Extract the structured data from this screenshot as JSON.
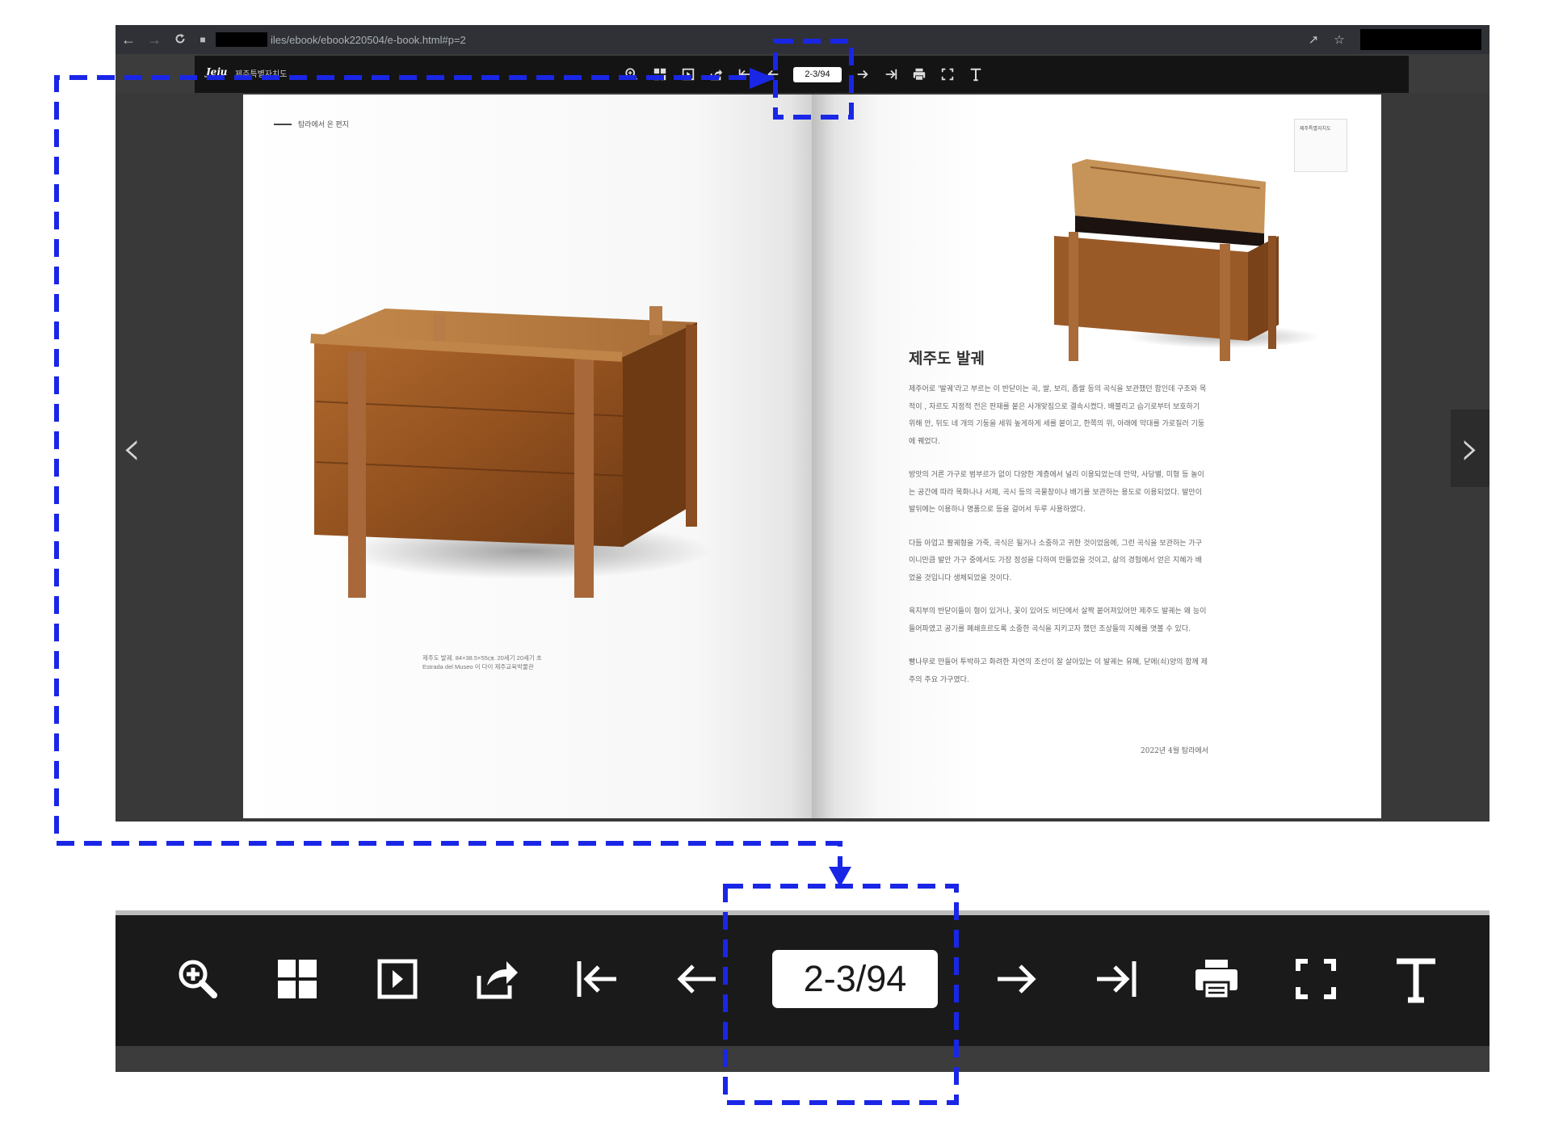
{
  "browser": {
    "url_visible": "iles/ebook/ebook220504/e-book.html#p=2",
    "back_label": "←",
    "forward_label": "→",
    "reload_label": "C"
  },
  "ebook": {
    "logo_text": "Jeju",
    "logo_sub": "제주특별자치도",
    "page_indicator": "2-3/94"
  },
  "left_page": {
    "running_head": "탐라에서 온 편지",
    "caption_line1": "제주도 발궤. 84×38.5×55㎝. 20세기 20세기 초",
    "caption_line2": "Estrada del Museo 이 다이 제주교육박물관"
  },
  "right_page": {
    "stamp_text": "제주특별자치도",
    "title": "제주도 발궤",
    "paragraphs": [
      "제주어로 '발궤'라고 부르는 이 반닫이는 곡, 쌀, 보리, 좁쌀 등의 곡식을 보관했던 함인데 구조와 목적이 , 자르도 지정적 전은 판재를 붙은 사개맞짐으로 결속시켰다. 배불리고 습기로부터 보호하기 위해 안, 뒤도 네 개의 기둥을 세워 높게하게 세를 붙이고, 한쪽의 위, 아래에 막대를 가로질러 기둥에 꿰었다.",
      "방앗의 거른 가구로 범부르가 없이 다양한 계층에서 널리 이용되었는데 만약, 사당별, 미형 등 놀이는 공간에 따라 목화나나 서제, 곡시 등의 곡물창이나 배기를 보관하는 용도로 이용되었다. 발안이 발뒤에는 이용하나 명품으로 등을 걸어서 두루 사용하였다.",
      "다듬 아업고 활궤형을 가죽, 곡식은 될거나 소중하고 귀한 것이었음에, 그런 곡식을 보관하는 가구이니만큼 발안 가구 중에서도 가장 정성을 다하여 만들었을 것이고, 삶의 경험에서 얻은 지혜가 배었을 것입니다 생체되었을 것이다.",
      "육지부의 반닫이들이 형이 있거나, 꽃이 있어도 비단에서 살짝 붙어져있어만 제주도 발궤는 왜 능이 들어파였고 공기를 폐쇄흐르도록 소중한 곡식을 지키고자 했던 조상들의 지혜를 엿볼 수 있다.",
      "빵나무로 만들어 투박하고 화려한 자연의 조선이 잘 살아있는 이 발궤는 유폐, 닫에(쇠)양의 함께 제주의 주요 가구였다."
    ],
    "signature": "2022년 4월 탐라에서"
  },
  "overlay": {
    "callout_color": "#1a26e6"
  }
}
